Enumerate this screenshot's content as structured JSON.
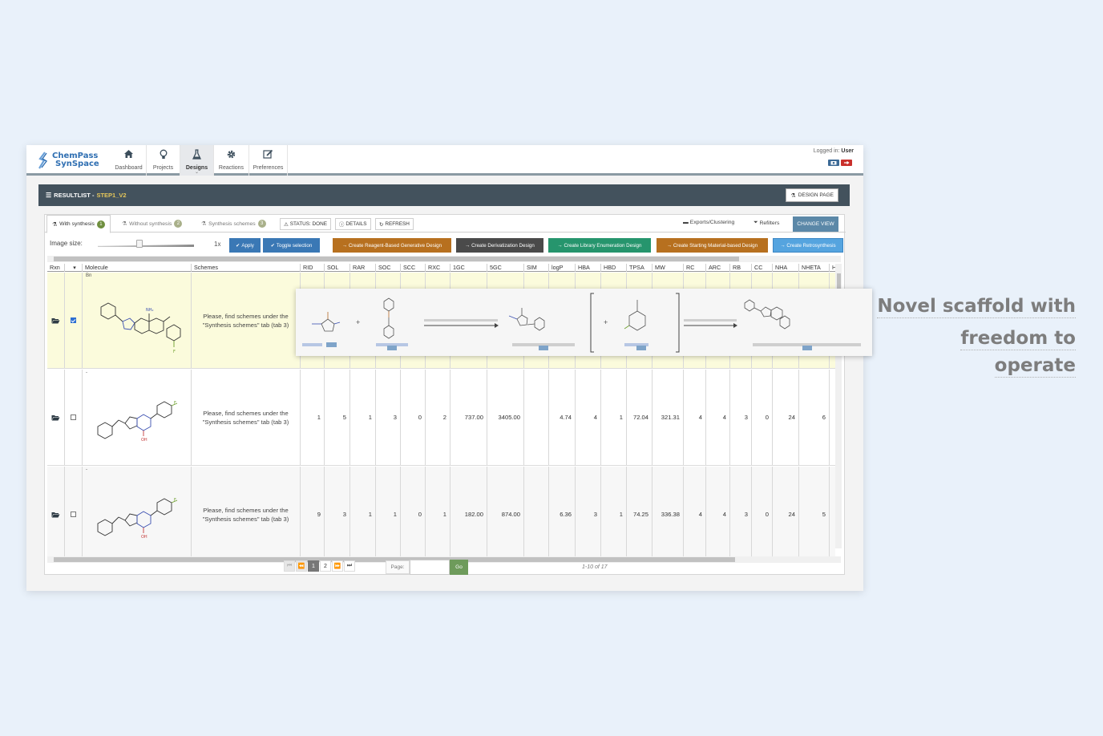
{
  "logo": {
    "line1": "ChemPass",
    "line2": "SynSpace"
  },
  "nav": {
    "items": [
      {
        "label": "Dashboard",
        "icon": "home-icon"
      },
      {
        "label": "Projects",
        "icon": "lightbulb-icon"
      },
      {
        "label": "Designs",
        "icon": "flask-icon"
      },
      {
        "label": "Reactions",
        "icon": "gear-icon"
      },
      {
        "label": "Preferences",
        "icon": "edit-icon"
      }
    ],
    "active": "Designs"
  },
  "login": {
    "prefix": "Logged in:",
    "user": "User"
  },
  "resultlist": {
    "label": "RESULTLIST - ",
    "step": "STEP1_V2",
    "design_page": "DESIGN PAGE"
  },
  "tabs": [
    {
      "label": "With synthesis",
      "badge": "1"
    },
    {
      "label": "Without synthesis",
      "badge": "2"
    },
    {
      "label": "Synthesis schemes",
      "badge": "3"
    }
  ],
  "toolbar": {
    "status": "STATUS: DONE",
    "details": "DETAILS",
    "refresh": "REFRESH",
    "exports": "Exports/Clustering",
    "refilters": "Refilters",
    "change_view": "CHANGE VIEW",
    "image_size": "Image size:",
    "zoom": "1x",
    "apply": "Apply",
    "toggle": "Toggle selection",
    "act1": "→ Create Reagent-Based Generative Design",
    "act2": "→ Create Derivatization Design",
    "act3": "→ Create Library Enumeration Design",
    "act4": "→ Create Starting Material-based Design",
    "act5": "→ Create Retrosynthesis"
  },
  "columns": [
    "Rxn",
    "",
    "Molecule",
    "Schemes",
    "RID",
    "SOL",
    "RAR",
    "SOC",
    "SCC",
    "RXC",
    "1GC",
    "5GC",
    "SIM",
    "logP",
    "HBA",
    "HBD",
    "TPSA",
    "MW",
    "RC",
    "ARC",
    "RB",
    "CC",
    "NHA",
    "NHETA",
    "H"
  ],
  "rows": [
    {
      "note": "Bn",
      "checked": true,
      "scheme": "Please, find schemes under the \"Synthesis schemes\" tab (tab 3)",
      "values": [
        "",
        "",
        "",
        "",
        "",
        "",
        "",
        "",
        "",
        "",
        "",
        "",
        "",
        "",
        "",
        "",
        "",
        "",
        "",
        "",
        ""
      ]
    },
    {
      "note": "-",
      "checked": false,
      "scheme": "Please, find schemes under the \"Synthesis schemes\" tab (tab 3)",
      "values": [
        "1",
        "5",
        "1",
        "3",
        "0",
        "2",
        "737.00",
        "3405.00",
        "",
        "4.74",
        "4",
        "1",
        "72.04",
        "321.31",
        "4",
        "4",
        "3",
        "0",
        "24",
        "6",
        ""
      ]
    },
    {
      "note": "-",
      "checked": false,
      "scheme": "Please, find schemes under the \"Synthesis schemes\" tab (tab 3)",
      "values": [
        "9",
        "3",
        "1",
        "1",
        "0",
        "1",
        "182.00",
        "874.00",
        "",
        "6.36",
        "3",
        "1",
        "74.25",
        "336.38",
        "4",
        "4",
        "3",
        "0",
        "24",
        "5",
        ""
      ]
    }
  ],
  "pagination": {
    "pages": [
      "1",
      "2"
    ],
    "current": "1",
    "page_label": "Page:",
    "go": "Go",
    "count": "1-10 of 17"
  },
  "headline": {
    "line1": "Novel scaffold with",
    "line2": "freedom to operate"
  },
  "colors": {
    "brand": "#2f6fb2",
    "header_bar": "#43525d",
    "highlight_row": "#fbfbdc",
    "headline": "#7d7d7d"
  }
}
